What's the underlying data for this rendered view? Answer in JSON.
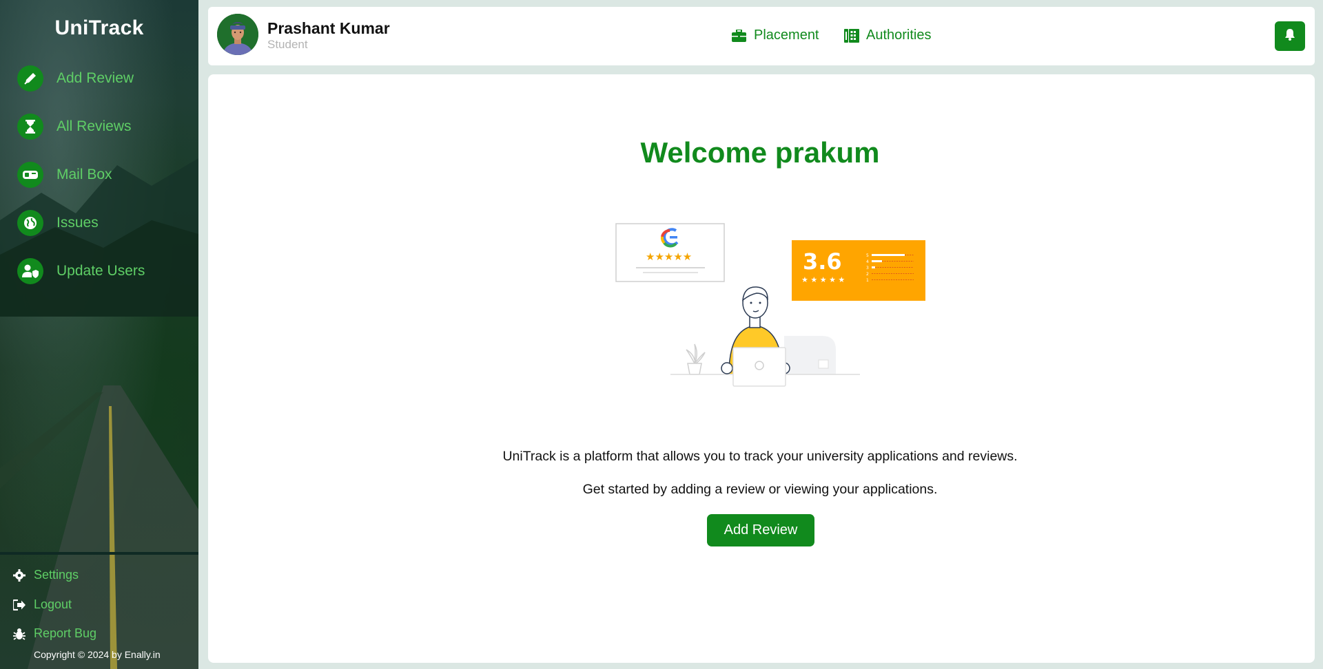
{
  "sidebar": {
    "brand": "UniTrack",
    "items": [
      {
        "label": "Add Review",
        "icon": "pen-icon"
      },
      {
        "label": "All Reviews",
        "icon": "hourglass-icon"
      },
      {
        "label": "Mail Box",
        "icon": "mailbox-icon"
      },
      {
        "label": "Issues",
        "icon": "globe-icon"
      },
      {
        "label": "Update Users",
        "icon": "user-shield-icon"
      }
    ],
    "footer": [
      {
        "label": "Settings",
        "icon": "gear-icon"
      },
      {
        "label": "Logout",
        "icon": "logout-icon"
      },
      {
        "label": "Report Bug",
        "icon": "bug-icon"
      }
    ],
    "copyright": "Copyright © 2024 by Enally.in"
  },
  "header": {
    "user_name": "Prashant Kumar",
    "user_role": "Student",
    "links": [
      {
        "label": "Placement",
        "icon": "briefcase-icon"
      },
      {
        "label": "Authorities",
        "icon": "address-book-icon"
      }
    ],
    "notification_icon": "bell-icon"
  },
  "main": {
    "welcome": "Welcome prakum",
    "illustration": {
      "rating": "3.6",
      "legend_levels": [
        "5",
        "4",
        "3",
        "2",
        "1"
      ]
    },
    "description_1": "UniTrack is a platform that allows you to track your university applications and reviews.",
    "description_2": "Get started by adding a review or viewing your applications.",
    "cta_label": "Add Review"
  },
  "colors": {
    "accent": "#118a1d",
    "sidebar_text": "#5fcf66",
    "rating_card": "#ffa500"
  }
}
